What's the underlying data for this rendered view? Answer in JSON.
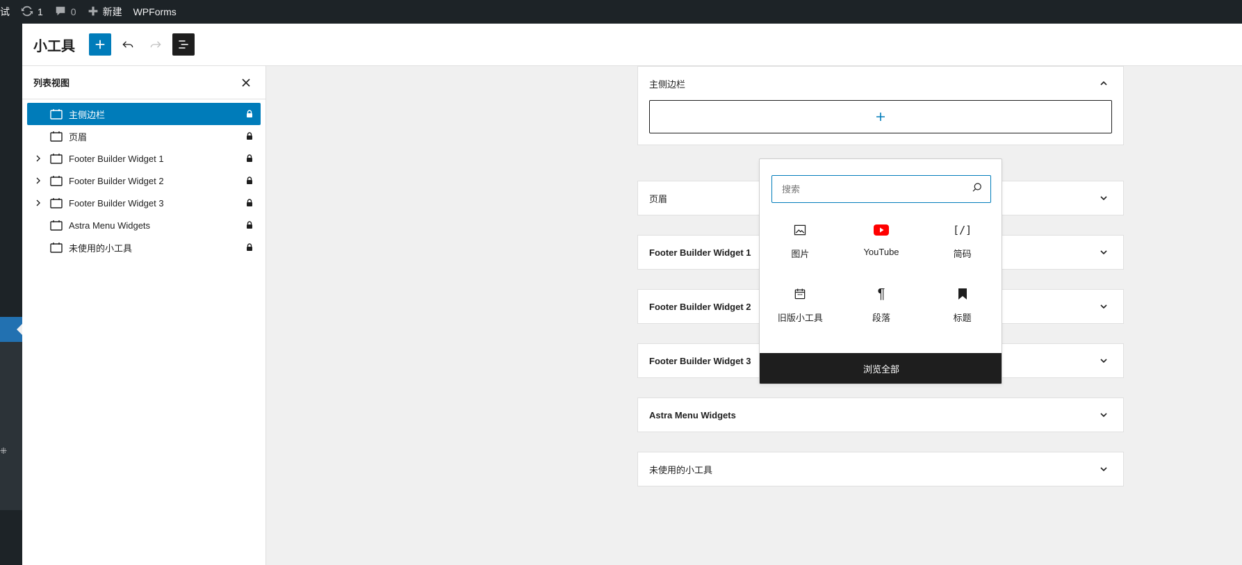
{
  "colors": {
    "accent": "#007cba",
    "admin_bar": "#1d2327",
    "dark": "#1e1e1e",
    "youtube": "#ff0000"
  },
  "admin_bar": {
    "site_fragment": "试",
    "updates_count": "1",
    "comments_count": "0",
    "new_label": "新建",
    "wpforms_label": "WPForms"
  },
  "header": {
    "title": "小工具",
    "add_icon": "plus-icon",
    "undo_icon": "undo-icon",
    "redo_icon": "redo-icon",
    "list_view_icon": "list-view-icon"
  },
  "list_view": {
    "title": "列表视图",
    "items": [
      {
        "label": "主侧边栏",
        "expandable": false,
        "selected": true
      },
      {
        "label": "页眉",
        "expandable": false,
        "selected": false
      },
      {
        "label": "Footer Builder Widget 1",
        "expandable": true,
        "selected": false
      },
      {
        "label": "Footer Builder Widget 2",
        "expandable": true,
        "selected": false
      },
      {
        "label": "Footer Builder Widget 3",
        "expandable": true,
        "selected": false
      },
      {
        "label": "Astra Menu Widgets",
        "expandable": false,
        "selected": false
      },
      {
        "label": "未使用的小工具",
        "expandable": false,
        "selected": false
      }
    ]
  },
  "widget_areas": [
    {
      "title": "主侧边栏",
      "open": true
    },
    {
      "title": "页眉",
      "open": false
    },
    {
      "title": "Footer Builder Widget 1",
      "open": false
    },
    {
      "title": "Footer Builder Widget 2",
      "open": false
    },
    {
      "title": "Footer Builder Widget 3",
      "open": false
    },
    {
      "title": "Astra Menu Widgets",
      "open": false
    },
    {
      "title": "未使用的小工具",
      "open": false
    }
  ],
  "inserter": {
    "search_placeholder": "搜索",
    "blocks": [
      {
        "label": "图片",
        "icon": "image-icon"
      },
      {
        "label": "YouTube",
        "icon": "youtube-icon"
      },
      {
        "label": "简码",
        "icon": "shortcode-icon"
      },
      {
        "label": "旧版小工具",
        "icon": "calendar-widget-icon"
      },
      {
        "label": "段落",
        "icon": "paragraph-icon"
      },
      {
        "label": "标题",
        "icon": "bookmark-icon"
      }
    ],
    "browse_all": "浏览全部"
  }
}
